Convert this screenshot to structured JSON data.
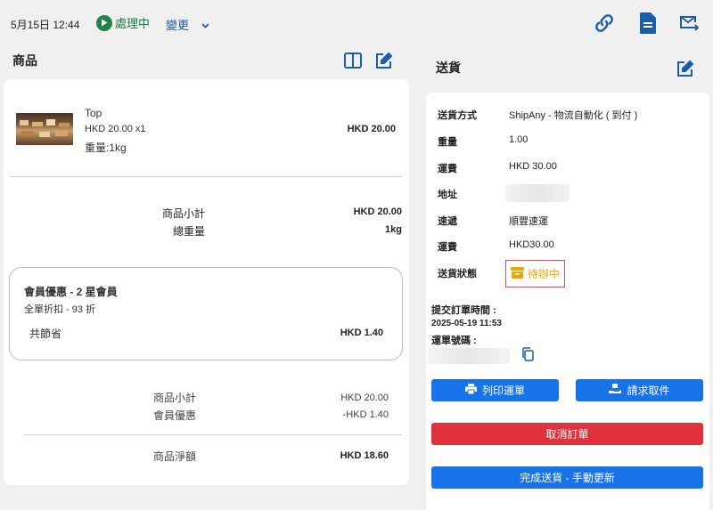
{
  "topbar": {
    "date": "5月15日 12:44",
    "status": "處理中",
    "change_label": "變更",
    "icons": [
      "link-icon",
      "document-icon",
      "mail-forward-icon"
    ]
  },
  "products": {
    "title": "商品",
    "item": {
      "name": "Top",
      "price_qty": "HKD 20.00 x1",
      "weight": "重量:1kg",
      "total": "HKD 20.00"
    },
    "subtotal_label": "商品小計",
    "subtotal_value": "HKD 20.00",
    "total_weight_label": "總重量",
    "total_weight_value": "1kg",
    "discount": {
      "title": "會員優惠 - 2 星會員",
      "desc": "全單折扣 - 93 折",
      "saved_label": "共節省",
      "saved_value": "HKD 1.40"
    },
    "summary": {
      "subtotal_label": "商品小計",
      "subtotal_value": "HKD 20.00",
      "member_label": "會員優惠",
      "member_value": "-HKD 1.40",
      "net_label": "商品淨額",
      "net_value": "HKD 18.60"
    }
  },
  "shipping": {
    "title": "送貨",
    "rows": [
      {
        "label": "送貨方式",
        "value": "ShipAny - 物流自動化 ( 到付 )"
      },
      {
        "label": "重量",
        "value": "1.00"
      },
      {
        "label": "運費",
        "value": "HKD 30.00"
      },
      {
        "label": "地址",
        "value": ""
      },
      {
        "label": "速遞",
        "value": "順豐速運"
      },
      {
        "label": "運費",
        "value": "HKD30.00"
      },
      {
        "label": "送貨狀態",
        "value": ""
      }
    ],
    "status_badge": "待辦中",
    "submitted_label": "提交訂單時間 :",
    "submitted_value": "2025-05-19 11:53",
    "tracking_label": "運單號碼 :",
    "buttons": {
      "print": "列印運單",
      "pickup": "請求取件",
      "cancel": "取消訂單",
      "complete": "完成送貨 - 手動更新"
    },
    "colors": {
      "primary": "#1873e8",
      "danger": "#e0323e",
      "pending": "#f0a500"
    }
  }
}
